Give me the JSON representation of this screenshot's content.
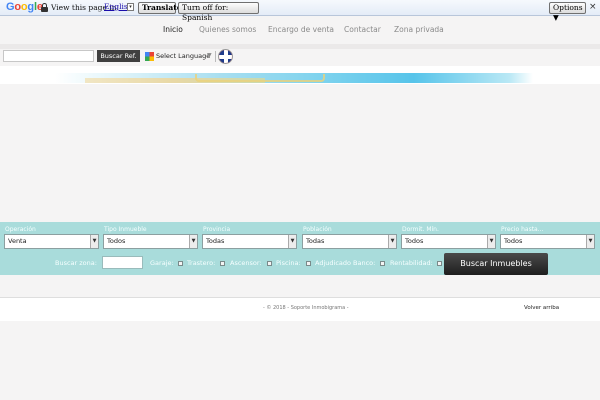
{
  "translate_bar": {
    "logo": "Google",
    "view_text": "View this page in:",
    "language": "English",
    "translate_btn": "Translate",
    "turn_off_btn": "Turn off for: Spanish",
    "options_btn": "Options ▼",
    "close": "×"
  },
  "nav": {
    "items": [
      "Inicio",
      "Quienes somos",
      "Encargo de venta",
      "Contactar",
      "Zona privada"
    ],
    "active": "Inicio"
  },
  "search": {
    "value": "",
    "button": "Buscar Ref.",
    "language_select": "Select Language",
    "language_arrow": "▼"
  },
  "filters": {
    "fields": [
      {
        "label": "Operación",
        "value": "Venta"
      },
      {
        "label": "Tipo Inmueble",
        "value": "Todos"
      },
      {
        "label": "Provincia",
        "value": "Todas"
      },
      {
        "label": "Población",
        "value": "Todas"
      },
      {
        "label": "Dormit. Mín.",
        "value": "Todos"
      },
      {
        "label": "Precio hasta...",
        "value": "Todos"
      }
    ],
    "zone_label": "Buscar zona:",
    "zone_value": "",
    "checkboxes": [
      "Garaje:",
      "Trastero:",
      "Ascensor:",
      "Piscina:",
      "Adjudicado Banco:",
      "Rentabilidad:"
    ],
    "submit": "Buscar Inmuebles"
  },
  "footer": {
    "copyright": "- © 2018 - Soporte Inmobigrama -",
    "back_to_top": "Volver arriba"
  },
  "colors": {
    "filter_bg": "#a9dcdb",
    "button_dark": "#2f2f2f"
  }
}
